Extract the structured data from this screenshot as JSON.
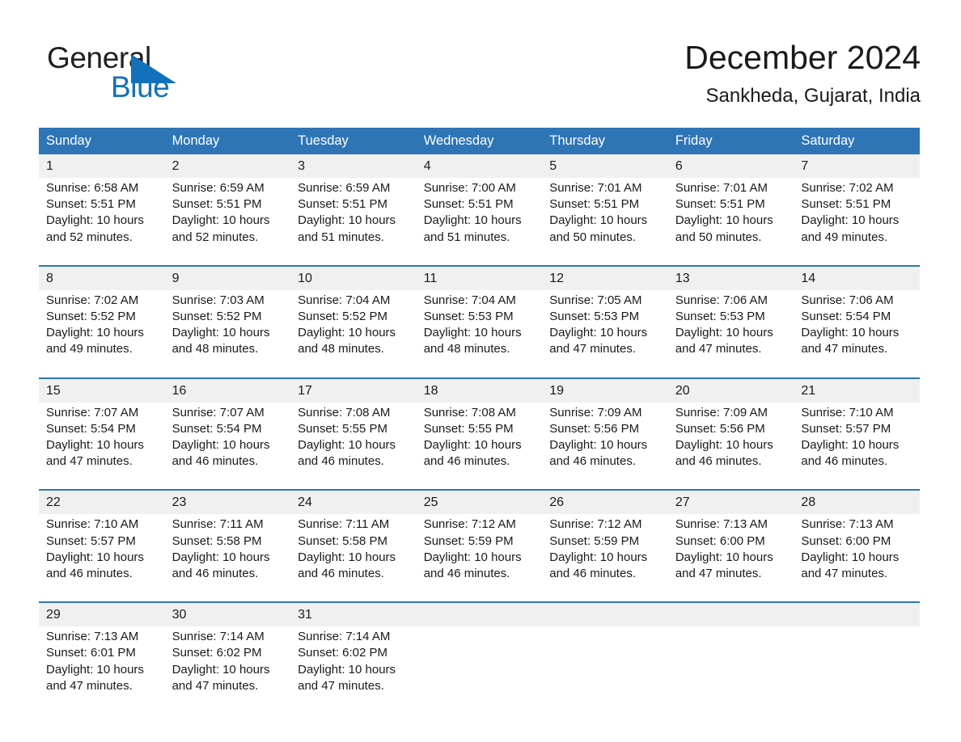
{
  "brand": {
    "name_part1": "General",
    "name_part2": "Blue",
    "accent_color": "#1271bb",
    "logo_icon": "triangle-flag-icon"
  },
  "header": {
    "month_title": "December 2024",
    "location": "Sankheda, Gujarat, India"
  },
  "colors": {
    "header_blue": "#2e75b6",
    "daynum_band": "#f0f0f0",
    "text": "#1a1a1a"
  },
  "calendar": {
    "weekday_headers": [
      "Sunday",
      "Monday",
      "Tuesday",
      "Wednesday",
      "Thursday",
      "Friday",
      "Saturday"
    ],
    "weeks": [
      [
        {
          "day": "1",
          "sunrise": "Sunrise: 6:58 AM",
          "sunset": "Sunset: 5:51 PM",
          "daylight": "Daylight: 10 hours and 52 minutes."
        },
        {
          "day": "2",
          "sunrise": "Sunrise: 6:59 AM",
          "sunset": "Sunset: 5:51 PM",
          "daylight": "Daylight: 10 hours and 52 minutes."
        },
        {
          "day": "3",
          "sunrise": "Sunrise: 6:59 AM",
          "sunset": "Sunset: 5:51 PM",
          "daylight": "Daylight: 10 hours and 51 minutes."
        },
        {
          "day": "4",
          "sunrise": "Sunrise: 7:00 AM",
          "sunset": "Sunset: 5:51 PM",
          "daylight": "Daylight: 10 hours and 51 minutes."
        },
        {
          "day": "5",
          "sunrise": "Sunrise: 7:01 AM",
          "sunset": "Sunset: 5:51 PM",
          "daylight": "Daylight: 10 hours and 50 minutes."
        },
        {
          "day": "6",
          "sunrise": "Sunrise: 7:01 AM",
          "sunset": "Sunset: 5:51 PM",
          "daylight": "Daylight: 10 hours and 50 minutes."
        },
        {
          "day": "7",
          "sunrise": "Sunrise: 7:02 AM",
          "sunset": "Sunset: 5:51 PM",
          "daylight": "Daylight: 10 hours and 49 minutes."
        }
      ],
      [
        {
          "day": "8",
          "sunrise": "Sunrise: 7:02 AM",
          "sunset": "Sunset: 5:52 PM",
          "daylight": "Daylight: 10 hours and 49 minutes."
        },
        {
          "day": "9",
          "sunrise": "Sunrise: 7:03 AM",
          "sunset": "Sunset: 5:52 PM",
          "daylight": "Daylight: 10 hours and 48 minutes."
        },
        {
          "day": "10",
          "sunrise": "Sunrise: 7:04 AM",
          "sunset": "Sunset: 5:52 PM",
          "daylight": "Daylight: 10 hours and 48 minutes."
        },
        {
          "day": "11",
          "sunrise": "Sunrise: 7:04 AM",
          "sunset": "Sunset: 5:53 PM",
          "daylight": "Daylight: 10 hours and 48 minutes."
        },
        {
          "day": "12",
          "sunrise": "Sunrise: 7:05 AM",
          "sunset": "Sunset: 5:53 PM",
          "daylight": "Daylight: 10 hours and 47 minutes."
        },
        {
          "day": "13",
          "sunrise": "Sunrise: 7:06 AM",
          "sunset": "Sunset: 5:53 PM",
          "daylight": "Daylight: 10 hours and 47 minutes."
        },
        {
          "day": "14",
          "sunrise": "Sunrise: 7:06 AM",
          "sunset": "Sunset: 5:54 PM",
          "daylight": "Daylight: 10 hours and 47 minutes."
        }
      ],
      [
        {
          "day": "15",
          "sunrise": "Sunrise: 7:07 AM",
          "sunset": "Sunset: 5:54 PM",
          "daylight": "Daylight: 10 hours and 47 minutes."
        },
        {
          "day": "16",
          "sunrise": "Sunrise: 7:07 AM",
          "sunset": "Sunset: 5:54 PM",
          "daylight": "Daylight: 10 hours and 46 minutes."
        },
        {
          "day": "17",
          "sunrise": "Sunrise: 7:08 AM",
          "sunset": "Sunset: 5:55 PM",
          "daylight": "Daylight: 10 hours and 46 minutes."
        },
        {
          "day": "18",
          "sunrise": "Sunrise: 7:08 AM",
          "sunset": "Sunset: 5:55 PM",
          "daylight": "Daylight: 10 hours and 46 minutes."
        },
        {
          "day": "19",
          "sunrise": "Sunrise: 7:09 AM",
          "sunset": "Sunset: 5:56 PM",
          "daylight": "Daylight: 10 hours and 46 minutes."
        },
        {
          "day": "20",
          "sunrise": "Sunrise: 7:09 AM",
          "sunset": "Sunset: 5:56 PM",
          "daylight": "Daylight: 10 hours and 46 minutes."
        },
        {
          "day": "21",
          "sunrise": "Sunrise: 7:10 AM",
          "sunset": "Sunset: 5:57 PM",
          "daylight": "Daylight: 10 hours and 46 minutes."
        }
      ],
      [
        {
          "day": "22",
          "sunrise": "Sunrise: 7:10 AM",
          "sunset": "Sunset: 5:57 PM",
          "daylight": "Daylight: 10 hours and 46 minutes."
        },
        {
          "day": "23",
          "sunrise": "Sunrise: 7:11 AM",
          "sunset": "Sunset: 5:58 PM",
          "daylight": "Daylight: 10 hours and 46 minutes."
        },
        {
          "day": "24",
          "sunrise": "Sunrise: 7:11 AM",
          "sunset": "Sunset: 5:58 PM",
          "daylight": "Daylight: 10 hours and 46 minutes."
        },
        {
          "day": "25",
          "sunrise": "Sunrise: 7:12 AM",
          "sunset": "Sunset: 5:59 PM",
          "daylight": "Daylight: 10 hours and 46 minutes."
        },
        {
          "day": "26",
          "sunrise": "Sunrise: 7:12 AM",
          "sunset": "Sunset: 5:59 PM",
          "daylight": "Daylight: 10 hours and 46 minutes."
        },
        {
          "day": "27",
          "sunrise": "Sunrise: 7:13 AM",
          "sunset": "Sunset: 6:00 PM",
          "daylight": "Daylight: 10 hours and 47 minutes."
        },
        {
          "day": "28",
          "sunrise": "Sunrise: 7:13 AM",
          "sunset": "Sunset: 6:00 PM",
          "daylight": "Daylight: 10 hours and 47 minutes."
        }
      ],
      [
        {
          "day": "29",
          "sunrise": "Sunrise: 7:13 AM",
          "sunset": "Sunset: 6:01 PM",
          "daylight": "Daylight: 10 hours and 47 minutes."
        },
        {
          "day": "30",
          "sunrise": "Sunrise: 7:14 AM",
          "sunset": "Sunset: 6:02 PM",
          "daylight": "Daylight: 10 hours and 47 minutes."
        },
        {
          "day": "31",
          "sunrise": "Sunrise: 7:14 AM",
          "sunset": "Sunset: 6:02 PM",
          "daylight": "Daylight: 10 hours and 47 minutes."
        },
        {
          "day": "",
          "sunrise": "",
          "sunset": "",
          "daylight": ""
        },
        {
          "day": "",
          "sunrise": "",
          "sunset": "",
          "daylight": ""
        },
        {
          "day": "",
          "sunrise": "",
          "sunset": "",
          "daylight": ""
        },
        {
          "day": "",
          "sunrise": "",
          "sunset": "",
          "daylight": ""
        }
      ]
    ]
  }
}
